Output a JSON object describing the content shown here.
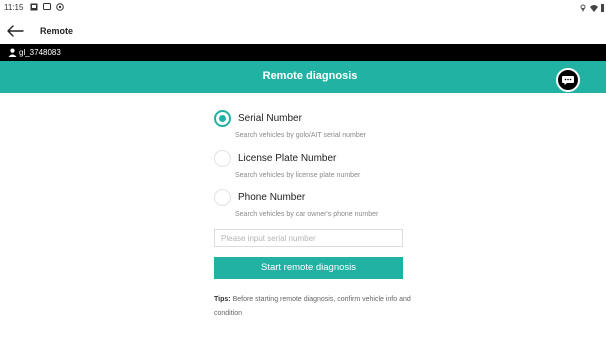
{
  "status": {
    "time": "11:15"
  },
  "titlebar": {
    "title": "Remote"
  },
  "user": {
    "id": "gl_3748083"
  },
  "header": {
    "title": "Remote diagnosis"
  },
  "options": [
    {
      "label": "Serial Number",
      "desc": "Search vehicles by golo/AIT serial number",
      "checked": true
    },
    {
      "label": "License Plate Number",
      "desc": "Search vehicles by license plate number",
      "checked": false
    },
    {
      "label": "Phone Number",
      "desc": "Search vehicles by car owner's phone number",
      "checked": false
    }
  ],
  "input": {
    "placeholder": "Please input serial number",
    "value": ""
  },
  "button": {
    "label": "Start remote diagnosis"
  },
  "tips": {
    "label": "Tips:",
    "text": "Before starting remote diagnosis, confirm vehicle info and condition"
  },
  "colors": {
    "accent": "#22b2a3",
    "userbar": "#000000"
  }
}
